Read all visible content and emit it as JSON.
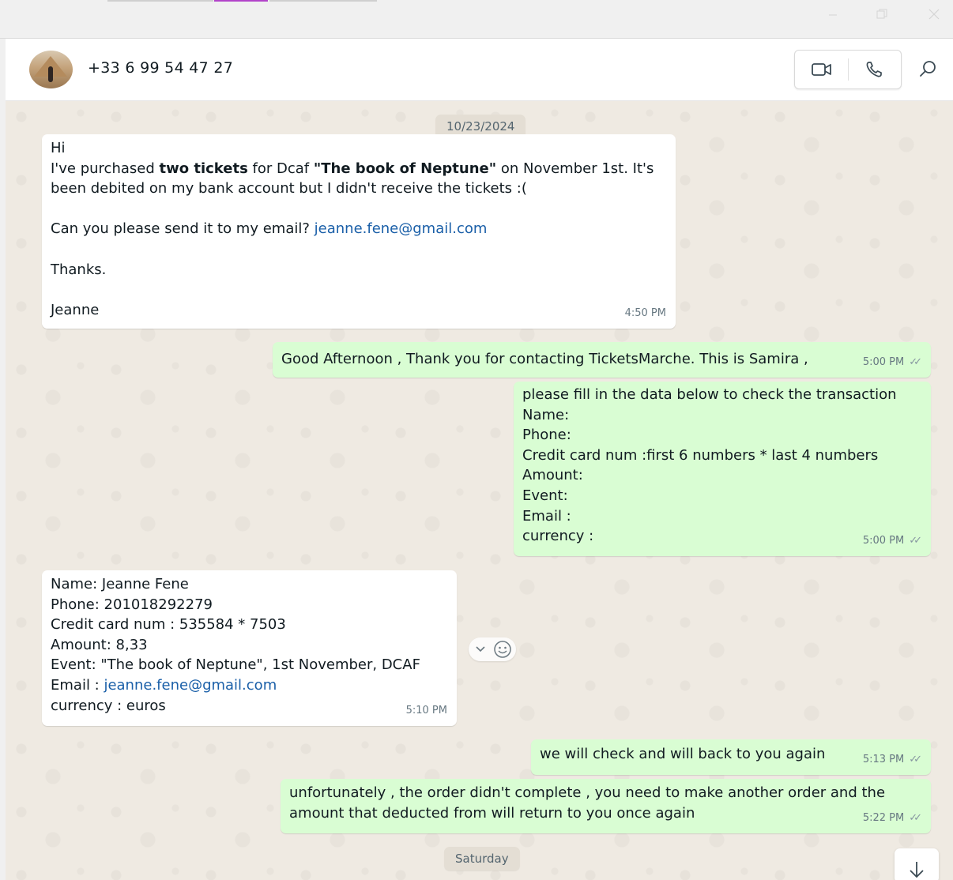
{
  "window": {
    "minimize_icon": "minimize-icon",
    "maximize_icon": "maximize-icon",
    "close_icon": "close-icon"
  },
  "header": {
    "contact": "+33 6 99 54 47 27",
    "icons": [
      "video-call-icon",
      "voice-call-icon",
      "search-icon"
    ]
  },
  "chat": {
    "date_top": "10/23/2024",
    "date_bottom": "Saturday",
    "messages": [
      {
        "direction": "in",
        "time": "4:50 PM",
        "greeting": "Hi",
        "l1_a": "I've purchased ",
        "l1_b": "two tickets",
        "l1_c": " for Dcaf ",
        "l1_d": "\"The book of Neptune\"",
        "l1_e": " on November 1st. It's",
        "l2": "been debited on my bank account but I didn't receive the tickets :(",
        "l3_a": "Can you please send it to my email? ",
        "l3_link": "jeanne.fene@gmail.com",
        "l4": "Thanks.",
        "l5": "Jeanne"
      },
      {
        "direction": "out",
        "time": "5:00 PM",
        "text": "Good  Afternoon , Thank you for contacting TicketsMarche. This is Samira ,"
      },
      {
        "direction": "out",
        "time": "5:00 PM",
        "lines": [
          "please fill in the data below to check the transaction",
          "Name:",
          "Phone:",
          "Credit card num :first 6 numbers * last 4 numbers",
          "Amount:",
          "Event:",
          "Email :",
          "currency :"
        ]
      },
      {
        "direction": "in",
        "time": "5:10 PM",
        "lines": [
          "Name: Jeanne Fene",
          "Phone: 201018292279",
          "Credit card num : 535584 * 7503",
          "Amount:  8,33",
          "Event: \"The book of Neptune\", 1st November, DCAF"
        ],
        "email_label": "Email : ",
        "email_link": "jeanne.fene@gmail.com",
        "currency": "currency : euros"
      },
      {
        "direction": "out",
        "time": "5:13 PM",
        "text": "we will check and will back to you again"
      },
      {
        "direction": "out",
        "time": "5:22 PM",
        "line1": "unfortunately , the order didn't complete , you need to make another order and the",
        "line2": "amount that deducted from will return to you once again"
      }
    ]
  }
}
